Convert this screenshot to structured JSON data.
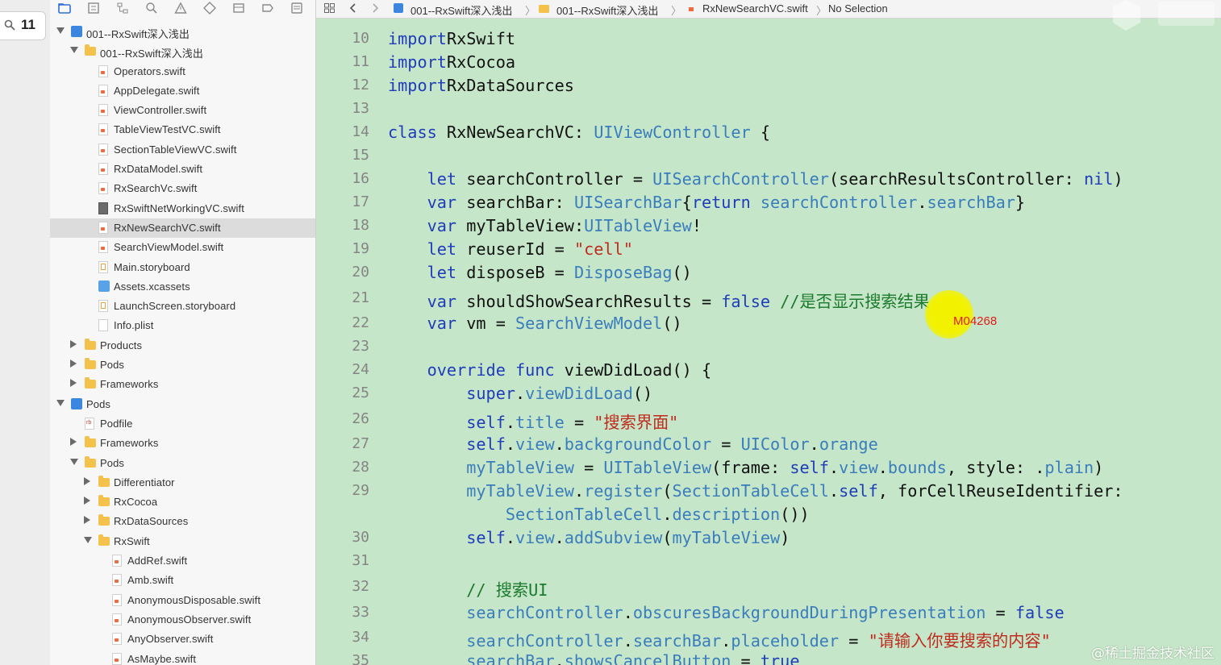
{
  "filter": {
    "value": "11"
  },
  "navigator": {
    "rows": [
      {
        "label": "001--RxSwift深入浅出",
        "indent": 0,
        "disclosure": "open",
        "icon": "project"
      },
      {
        "label": "001--RxSwift深入浅出",
        "indent": 1,
        "disclosure": "open",
        "icon": "folder"
      },
      {
        "label": "Operators.swift",
        "indent": 2,
        "icon": "swift"
      },
      {
        "label": "AppDelegate.swift",
        "indent": 2,
        "icon": "swift"
      },
      {
        "label": "ViewController.swift",
        "indent": 2,
        "icon": "swift"
      },
      {
        "label": "TableViewTestVC.swift",
        "indent": 2,
        "icon": "swift"
      },
      {
        "label": "SectionTableViewVC.swift",
        "indent": 2,
        "icon": "swift"
      },
      {
        "label": "RxDataModel.swift",
        "indent": 2,
        "icon": "swift"
      },
      {
        "label": "RxSearchVc.swift",
        "indent": 2,
        "icon": "swift"
      },
      {
        "label": "RxSwiftNetWorkingVC.swift",
        "indent": 2,
        "icon": "generic"
      },
      {
        "label": "RxNewSearchVC.swift",
        "indent": 2,
        "icon": "swift",
        "selected": true
      },
      {
        "label": "SearchViewModel.swift",
        "indent": 2,
        "icon": "swift"
      },
      {
        "label": "Main.storyboard",
        "indent": 2,
        "icon": "story"
      },
      {
        "label": "Assets.xcassets",
        "indent": 2,
        "icon": "assets"
      },
      {
        "label": "LaunchScreen.storyboard",
        "indent": 2,
        "icon": "story"
      },
      {
        "label": "Info.plist",
        "indent": 2,
        "icon": "plist"
      },
      {
        "label": "Products",
        "indent": 1,
        "disclosure": "closed",
        "icon": "folder"
      },
      {
        "label": "Pods",
        "indent": 1,
        "disclosure": "closed",
        "icon": "folder"
      },
      {
        "label": "Frameworks",
        "indent": 1,
        "disclosure": "closed",
        "icon": "folder"
      },
      {
        "label": "Pods",
        "indent": 0,
        "disclosure": "open",
        "icon": "project"
      },
      {
        "label": "Podfile",
        "indent": 1,
        "icon": "pod"
      },
      {
        "label": "Frameworks",
        "indent": 1,
        "disclosure": "closed",
        "icon": "folder"
      },
      {
        "label": "Pods",
        "indent": 1,
        "disclosure": "open",
        "icon": "folder"
      },
      {
        "label": "Differentiator",
        "indent": 2,
        "disclosure": "closed",
        "icon": "folder"
      },
      {
        "label": "RxCocoa",
        "indent": 2,
        "disclosure": "closed",
        "icon": "folder"
      },
      {
        "label": "RxDataSources",
        "indent": 2,
        "disclosure": "closed",
        "icon": "folder"
      },
      {
        "label": "RxSwift",
        "indent": 2,
        "disclosure": "open",
        "icon": "folder"
      },
      {
        "label": "AddRef.swift",
        "indent": 3,
        "icon": "swift"
      },
      {
        "label": "Amb.swift",
        "indent": 3,
        "icon": "swift"
      },
      {
        "label": "AnonymousDisposable.swift",
        "indent": 3,
        "icon": "swift"
      },
      {
        "label": "AnonymousObserver.swift",
        "indent": 3,
        "icon": "swift"
      },
      {
        "label": "AnyObserver.swift",
        "indent": 3,
        "icon": "swift"
      },
      {
        "label": "AsMaybe.swift",
        "indent": 3,
        "icon": "swift"
      }
    ]
  },
  "jumpbar": {
    "project": "001--RxSwift深入浅出",
    "group": "001--RxSwift深入浅出",
    "file": "RxNewSearchVC.swift",
    "selection": "No Selection"
  },
  "code": {
    "lines": [
      {
        "n": "10",
        "t": [
          [
            "kw",
            "import"
          ],
          [
            "",
            "RxSwift"
          ]
        ]
      },
      {
        "n": "11",
        "t": [
          [
            "kw",
            "import"
          ],
          [
            "",
            "RxCocoa"
          ]
        ]
      },
      {
        "n": "12",
        "t": [
          [
            "kw",
            "import"
          ],
          [
            "",
            "RxDataSources"
          ]
        ]
      },
      {
        "n": "13",
        "t": []
      },
      {
        "n": "14",
        "t": [
          [
            "kw",
            "class"
          ],
          [
            "",
            " RxNewSearchVC: "
          ],
          [
            "ty",
            "UIViewController"
          ],
          [
            "",
            " {"
          ]
        ]
      },
      {
        "n": "15",
        "t": []
      },
      {
        "n": "16",
        "t": [
          [
            "",
            "    "
          ],
          [
            "kw",
            "let"
          ],
          [
            "",
            " searchController = "
          ],
          [
            "ty",
            "UISearchController"
          ],
          [
            "",
            "(searchResultsController: "
          ],
          [
            "kw",
            "nil"
          ],
          [
            "",
            ")"
          ]
        ]
      },
      {
        "n": "17",
        "t": [
          [
            "",
            "    "
          ],
          [
            "kw",
            "var"
          ],
          [
            "",
            " searchBar: "
          ],
          [
            "ty",
            "UISearchBar"
          ],
          [
            "",
            "{"
          ],
          [
            "kw",
            "return"
          ],
          [
            "",
            " "
          ],
          [
            "fn",
            "searchController"
          ],
          [
            "",
            "."
          ],
          [
            "fn",
            "searchBar"
          ],
          [
            "",
            "}"
          ]
        ]
      },
      {
        "n": "18",
        "t": [
          [
            "",
            "    "
          ],
          [
            "kw",
            "var"
          ],
          [
            "",
            " myTableView:"
          ],
          [
            "ty",
            "UITableView"
          ],
          [
            "",
            "!"
          ]
        ]
      },
      {
        "n": "19",
        "t": [
          [
            "",
            "    "
          ],
          [
            "kw",
            "let"
          ],
          [
            "",
            " reuserId = "
          ],
          [
            "str",
            "\"cell\""
          ]
        ]
      },
      {
        "n": "20",
        "t": [
          [
            "",
            "    "
          ],
          [
            "kw",
            "let"
          ],
          [
            "",
            " disposeB = "
          ],
          [
            "ty",
            "DisposeBag"
          ],
          [
            "",
            "()"
          ]
        ]
      },
      {
        "n": "21",
        "t": [
          [
            "",
            "    "
          ],
          [
            "kw",
            "var"
          ],
          [
            "",
            " shouldShowSearchResults = "
          ],
          [
            "kw",
            "false"
          ],
          [
            "",
            " "
          ],
          [
            "cm",
            "//是否显示搜索结果"
          ]
        ]
      },
      {
        "n": "22",
        "t": [
          [
            "",
            "    "
          ],
          [
            "kw",
            "var"
          ],
          [
            "",
            " vm = "
          ],
          [
            "ty",
            "SearchViewModel"
          ],
          [
            "",
            "()"
          ]
        ]
      },
      {
        "n": "23",
        "t": []
      },
      {
        "n": "24",
        "t": [
          [
            "",
            "    "
          ],
          [
            "kw",
            "override"
          ],
          [
            "",
            " "
          ],
          [
            "kw",
            "func"
          ],
          [
            "",
            " viewDidLoad() {"
          ]
        ]
      },
      {
        "n": "25",
        "t": [
          [
            "",
            "        "
          ],
          [
            "kw",
            "super"
          ],
          [
            "",
            "."
          ],
          [
            "fn",
            "viewDidLoad"
          ],
          [
            "",
            "()"
          ]
        ]
      },
      {
        "n": "26",
        "t": [
          [
            "",
            "        "
          ],
          [
            "kw",
            "self"
          ],
          [
            "",
            "."
          ],
          [
            "fn",
            "title"
          ],
          [
            "",
            " = "
          ],
          [
            "str",
            "\"搜索界面\""
          ]
        ]
      },
      {
        "n": "27",
        "t": [
          [
            "",
            "        "
          ],
          [
            "kw",
            "self"
          ],
          [
            "",
            "."
          ],
          [
            "fn",
            "view"
          ],
          [
            "",
            "."
          ],
          [
            "fn",
            "backgroundColor"
          ],
          [
            "",
            " = "
          ],
          [
            "ty",
            "UIColor"
          ],
          [
            "",
            "."
          ],
          [
            "fn",
            "orange"
          ]
        ]
      },
      {
        "n": "28",
        "t": [
          [
            "",
            "        "
          ],
          [
            "fn",
            "myTableView"
          ],
          [
            "",
            " = "
          ],
          [
            "ty",
            "UITableView"
          ],
          [
            "",
            "(frame: "
          ],
          [
            "kw",
            "self"
          ],
          [
            "",
            "."
          ],
          [
            "fn",
            "view"
          ],
          [
            "",
            "."
          ],
          [
            "fn",
            "bounds"
          ],
          [
            "",
            ", style: ."
          ],
          [
            "fn",
            "plain"
          ],
          [
            "",
            ")"
          ]
        ]
      },
      {
        "n": "29",
        "t": [
          [
            "",
            "        "
          ],
          [
            "fn",
            "myTableView"
          ],
          [
            "",
            "."
          ],
          [
            "fn",
            "register"
          ],
          [
            "",
            "("
          ],
          [
            "ty",
            "SectionTableCell"
          ],
          [
            "",
            "."
          ],
          [
            "kw",
            "self"
          ],
          [
            "",
            ", forCellReuseIdentifier:"
          ]
        ]
      },
      {
        "n": "",
        "t": [
          [
            "",
            "            "
          ],
          [
            "ty",
            "SectionTableCell"
          ],
          [
            "",
            "."
          ],
          [
            "fn",
            "description"
          ],
          [
            "",
            "())"
          ]
        ]
      },
      {
        "n": "30",
        "t": [
          [
            "",
            "        "
          ],
          [
            "kw",
            "self"
          ],
          [
            "",
            "."
          ],
          [
            "fn",
            "view"
          ],
          [
            "",
            "."
          ],
          [
            "fn",
            "addSubview"
          ],
          [
            "",
            "("
          ],
          [
            "fn",
            "myTableView"
          ],
          [
            "",
            ")"
          ]
        ]
      },
      {
        "n": "31",
        "t": []
      },
      {
        "n": "32",
        "t": [
          [
            "",
            "        "
          ],
          [
            "cm",
            "// 搜索UI"
          ]
        ]
      },
      {
        "n": "33",
        "t": [
          [
            "",
            "        "
          ],
          [
            "fn",
            "searchController"
          ],
          [
            "",
            "."
          ],
          [
            "fn",
            "obscuresBackgroundDuringPresentation"
          ],
          [
            "",
            " = "
          ],
          [
            "kw",
            "false"
          ]
        ]
      },
      {
        "n": "34",
        "t": [
          [
            "",
            "        "
          ],
          [
            "fn",
            "searchController"
          ],
          [
            "",
            "."
          ],
          [
            "fn",
            "searchBar"
          ],
          [
            "",
            "."
          ],
          [
            "fn",
            "placeholder"
          ],
          [
            "",
            " = "
          ],
          [
            "str",
            "\"请输入你要搜索的内容\""
          ]
        ]
      },
      {
        "n": "35",
        "t": [
          [
            "",
            "        "
          ],
          [
            "fn",
            "searchBar"
          ],
          [
            "",
            "."
          ],
          [
            "fn",
            "showsCancelButton"
          ],
          [
            "",
            " = "
          ],
          [
            "kw",
            "true"
          ]
        ]
      }
    ]
  },
  "overlay": {
    "cursor_text": "M04268"
  },
  "watermark": "@稀土掘金技术社区",
  "colors": {
    "editor_bg": "#c5e6c8",
    "keyword": "#1f3cba",
    "type": "#3a7dbd",
    "string": "#c02a1d",
    "comment": "#1c7a2d"
  }
}
